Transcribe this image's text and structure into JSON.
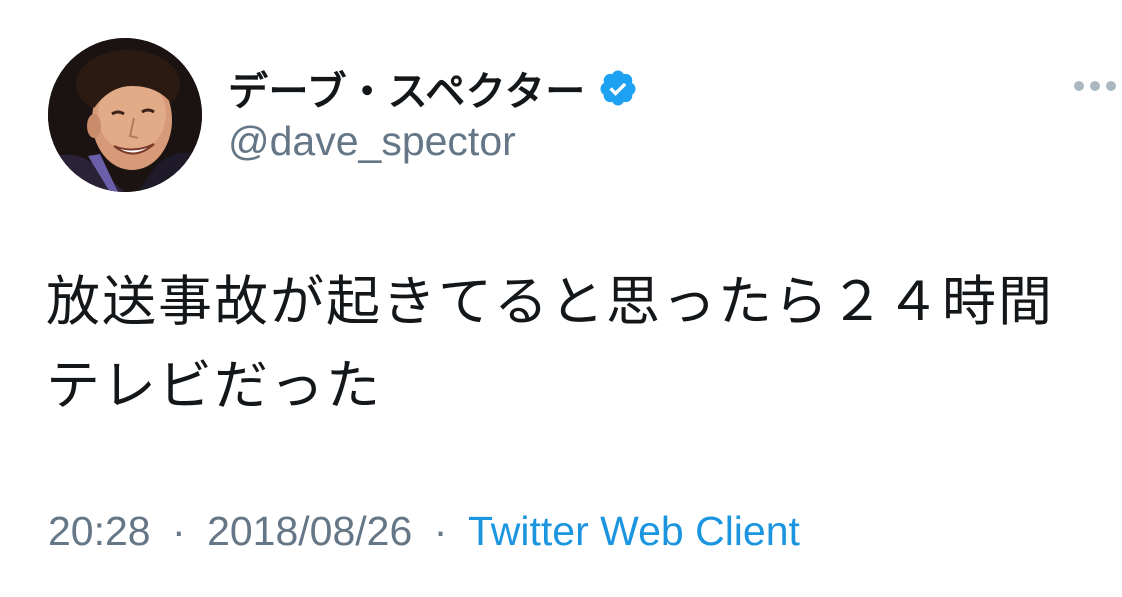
{
  "user": {
    "display_name": "デーブ・スペクター",
    "handle": "@dave_spector",
    "verified": true,
    "avatar_icon": "profile-photo"
  },
  "tweet": {
    "text": "放送事故が起きてると思ったら２４時間テレビだった",
    "time": "20:28",
    "date": "2018/08/26",
    "separator": "·",
    "source": "Twitter Web Client"
  },
  "more_icon": "more-dots-icon",
  "colors": {
    "text": "#14171a",
    "secondary": "#657786",
    "link": "#1b95e0",
    "verified": "#1da1f2"
  }
}
